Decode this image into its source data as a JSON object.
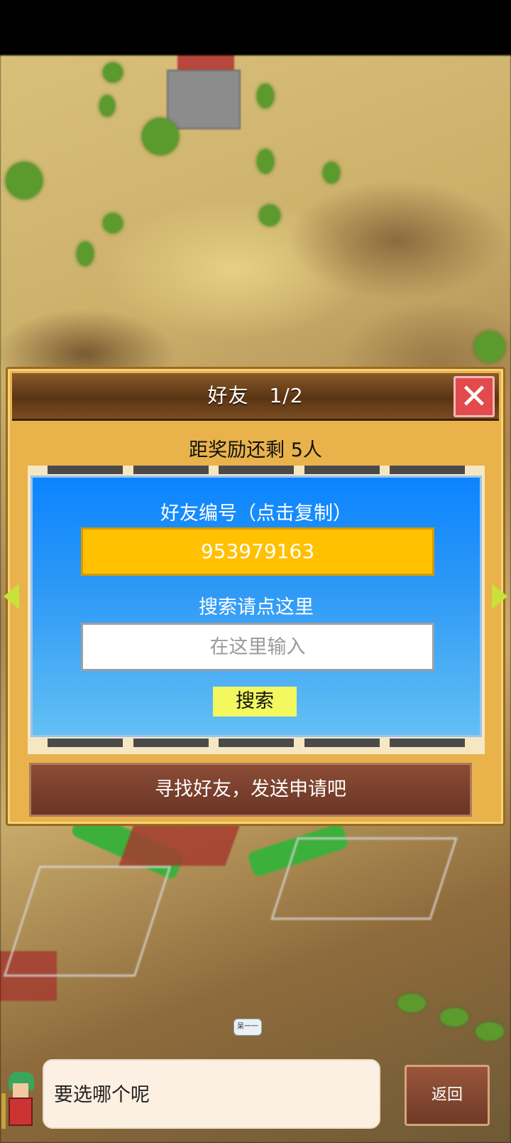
{
  "dialog": {
    "title": "好友　1/2",
    "reward_text": "距奖励还剩 5人",
    "close_symbol": "✕"
  },
  "panel": {
    "friend_id_label": "好友编号（点击复制）",
    "friend_id": "953979163",
    "search_label": "搜索请点这里",
    "search_placeholder": "在这里输入",
    "search_button": "搜索"
  },
  "find_button": "寻找好友，发送申请吧",
  "map": {
    "speech_small": "呆一一"
  },
  "chat": {
    "message": "要选哪个呢",
    "back_button": "返回"
  },
  "colors": {
    "dialog_bg": "#e9b24a",
    "header": "#5a3413",
    "panel_blue": "#0b84ff",
    "id_box": "#ffc100",
    "search_button": "#f2f85e",
    "close": "#e24b4b"
  },
  "icons": {
    "close": "close-icon",
    "prev_page": "arrow-left-icon",
    "next_page": "arrow-right-icon"
  }
}
